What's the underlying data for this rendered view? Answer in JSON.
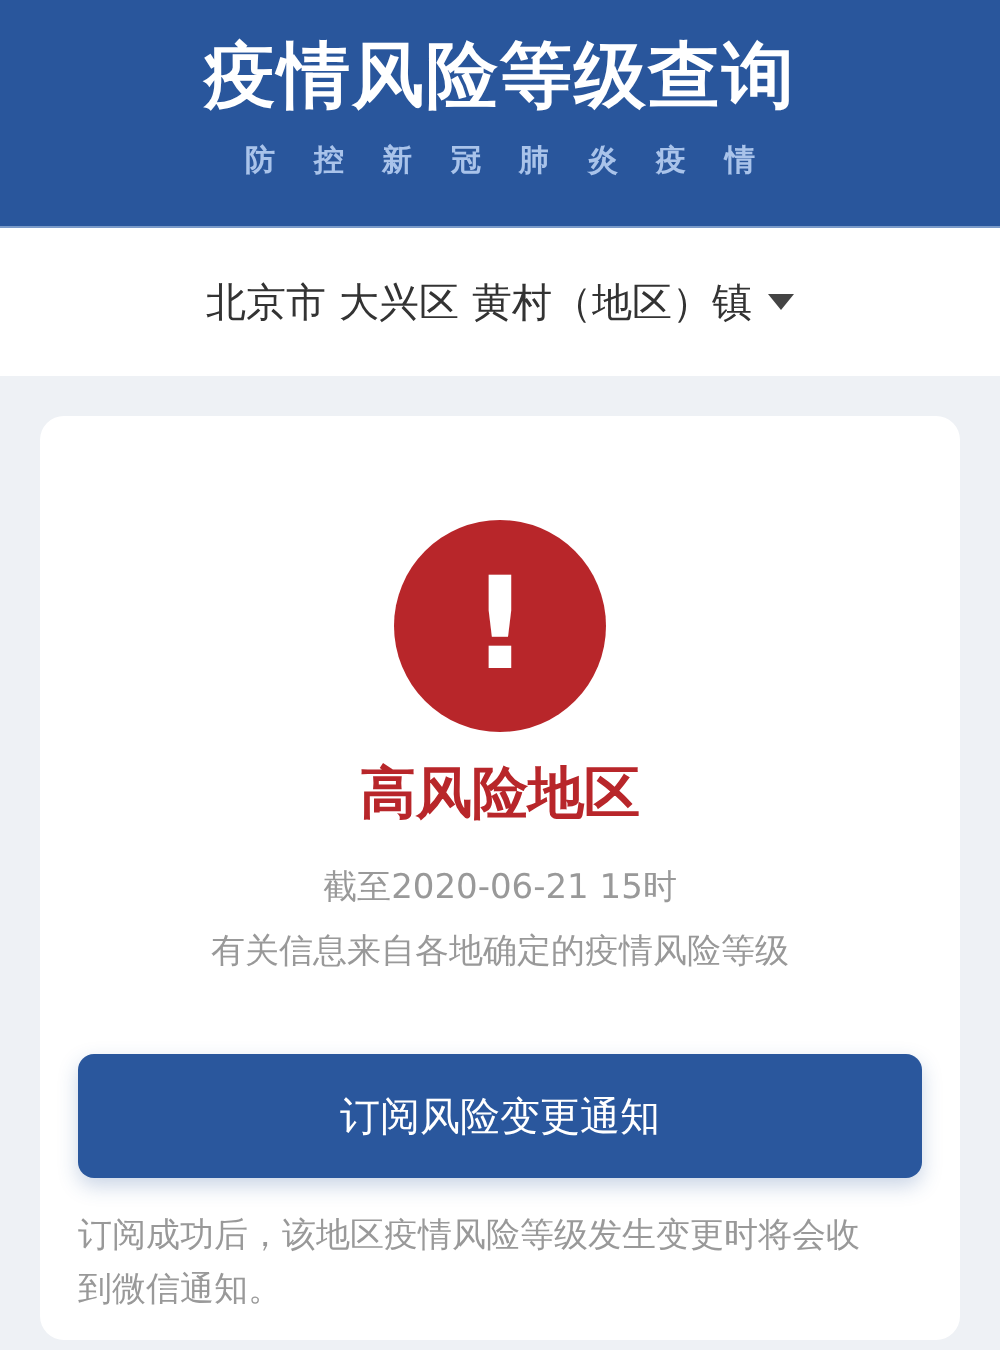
{
  "header": {
    "title": "疫情风险等级查询",
    "subtitle": "防 控 新 冠 肺 炎 疫 情"
  },
  "location": {
    "text": "北京市 大兴区 黄村（地区）镇",
    "expanded": false
  },
  "result": {
    "kind": "high",
    "icon_glyph": "!",
    "label": "高风险地区",
    "as_of": "截至2020-06-21 15时",
    "source": "有关信息来自各地确定的疫情风险等级"
  },
  "subscribe_button": "订阅风险变更通知",
  "note": "订阅成功后，该地区疫情风险等级发生变更时将会收到微信通知。"
}
